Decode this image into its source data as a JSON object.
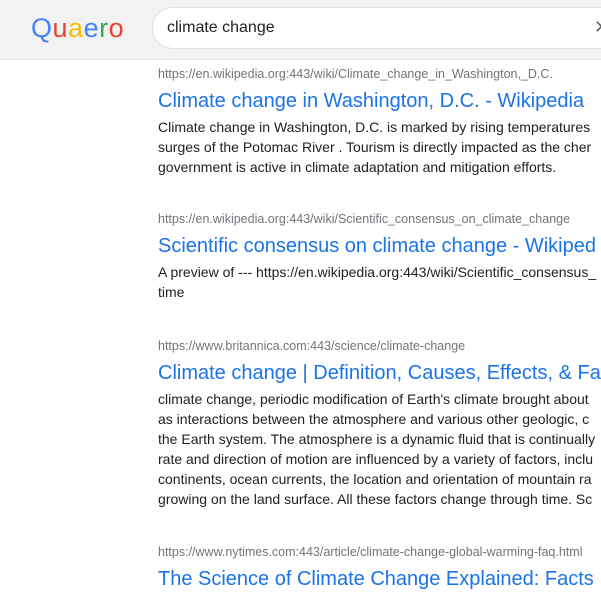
{
  "logo": {
    "letters": [
      {
        "char": "Q",
        "color": "#4285f4"
      },
      {
        "char": "u",
        "color": "#ea4335"
      },
      {
        "char": "a",
        "color": "#fbbc05"
      },
      {
        "char": "e",
        "color": "#4285f4"
      },
      {
        "char": "r",
        "color": "#34a853"
      },
      {
        "char": "o",
        "color": "#ea4335"
      }
    ]
  },
  "search": {
    "value": "climate change",
    "clear_icon": "close-icon",
    "clear_glyph": "✕"
  },
  "results": [
    {
      "url": "https://en.wikipedia.org:443/wiki/Climate_change_in_Washington,_D.C.",
      "title": "Climate change in Washington, D.C. - Wikipedia",
      "snippet_lines": [
        "Climate change in Washington, D.C. is marked by rising temperatures",
        "surges of the Potomac River . Tourism is directly impacted as the cher",
        "government is active in climate adaptation and mitigation efforts."
      ]
    },
    {
      "url": "https://en.wikipedia.org:443/wiki/Scientific_consensus_on_climate_change",
      "title": "Scientific consensus on climate change - Wikiped",
      "snippet_lines": [
        "A preview of --- https://en.wikipedia.org:443/wiki/Scientific_consensus_",
        "time"
      ]
    },
    {
      "url": "https://www.britannica.com:443/science/climate-change",
      "title": "Climate change | Definition, Causes, Effects, & Fa",
      "snippet_lines": [
        "climate change, periodic modification of Earth's climate brought about",
        "as interactions between the atmosphere and various other geologic, c",
        "the Earth system. The atmosphere is a dynamic fluid that is continually",
        "rate and direction of motion are influenced by a variety of factors, inclu",
        "continents, ocean currents, the location and orientation of mountain ra",
        "growing on the land surface. All these factors change through time. Sc"
      ]
    },
    {
      "url": "https://www.nytimes.com:443/article/climate-change-global-warming-faq.html",
      "title": "The Science of Climate Change Explained: Facts",
      "snippet_lines": []
    }
  ],
  "colors": {
    "link": "#1a73e8",
    "url": "#70757a",
    "text": "#202124",
    "header_bg": "#f2f2f2"
  }
}
